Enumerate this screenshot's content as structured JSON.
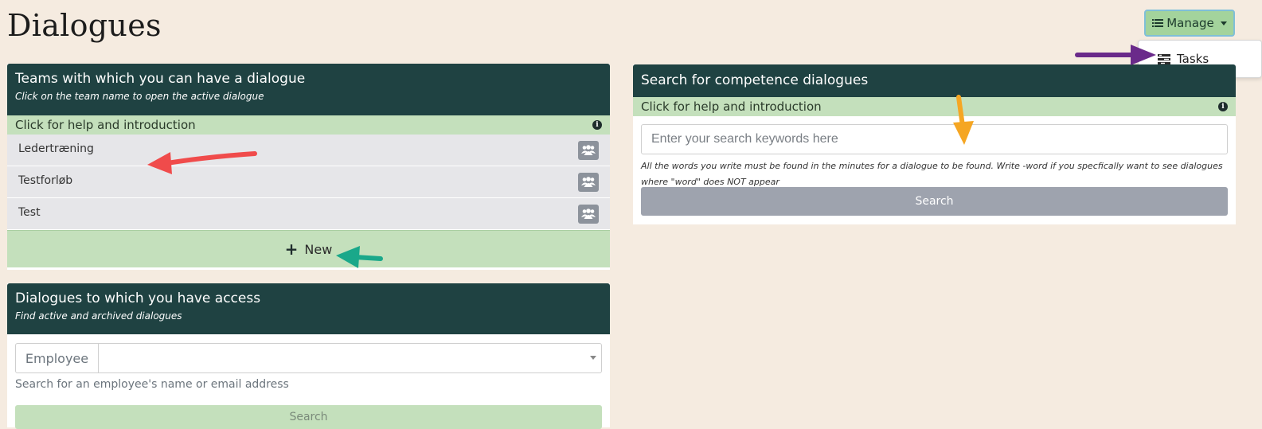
{
  "page": {
    "title": "Dialogues"
  },
  "manage": {
    "label": "Manage",
    "icon": "list-icon"
  },
  "dropdown": {
    "items": [
      {
        "label": "Tasks",
        "icon": "tasks-icon"
      }
    ]
  },
  "teams_card": {
    "title": "Teams with which you can have a dialogue",
    "subtitle": "Click on the team name to open the active dialogue",
    "help": "Click for help and introduction",
    "teams": [
      {
        "name": "Ledertræning",
        "icon": "users-icon"
      },
      {
        "name": "Testforløb",
        "icon": "users-icon"
      },
      {
        "name": "Test",
        "icon": "users-icon"
      }
    ],
    "new_label": "New"
  },
  "access_card": {
    "title": "Dialogues to which you have access",
    "subtitle": "Find active and archived dialogues",
    "employee_label": "Employee",
    "employee_value": "",
    "help_text": "Search for an employee's name or email address",
    "search_label": "Search"
  },
  "search_card": {
    "title": "Search for competence dialogues",
    "help": "Click for help and introduction",
    "placeholder": "Enter your search keywords here",
    "hint": "All the words you write must be found in the minutes for a dialogue to be found. Write -word if you specfically want to see dialogues where \"word\" does NOT appear",
    "search_label": "Search"
  },
  "colors": {
    "background": "#f5ebe0",
    "header": "#1f4242",
    "green": "#c4e0bc",
    "arrow_red": "#f04b4b",
    "arrow_teal": "#1aa88a",
    "arrow_purple": "#6a2a8a",
    "arrow_orange": "#f5a623"
  }
}
